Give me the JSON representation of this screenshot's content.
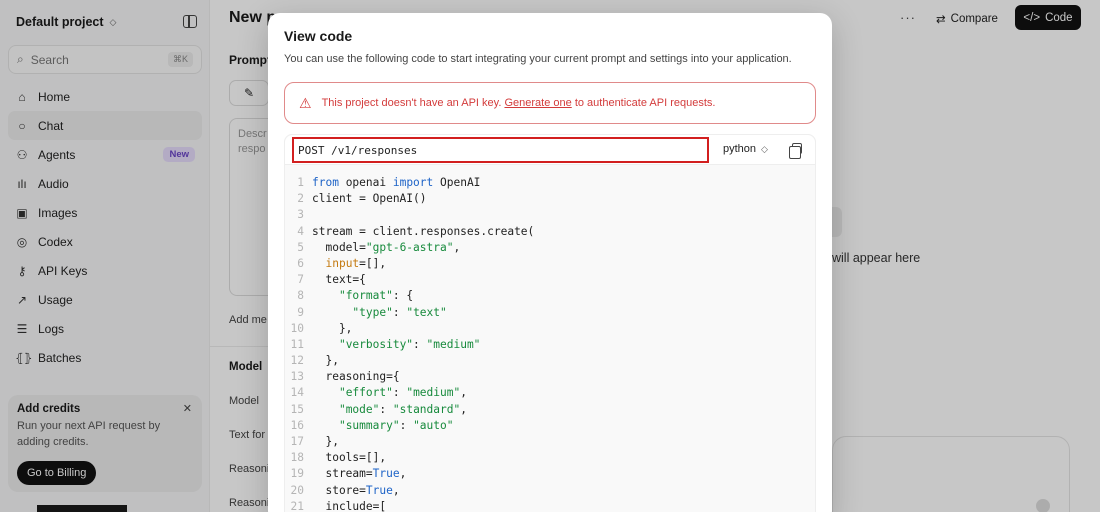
{
  "sidebar": {
    "project": "Default project",
    "search_placeholder": "Search",
    "search_shortcut": "⌘K",
    "items": [
      {
        "label": "Home",
        "icon": "home-icon"
      },
      {
        "label": "Chat",
        "icon": "chat-icon",
        "active": true
      },
      {
        "label": "Agents",
        "icon": "agents-icon",
        "badge": "New"
      },
      {
        "label": "Audio",
        "icon": "audio-icon"
      },
      {
        "label": "Images",
        "icon": "images-icon"
      },
      {
        "label": "Codex",
        "icon": "codex-icon"
      },
      {
        "label": "API Keys",
        "icon": "key-icon"
      },
      {
        "label": "Usage",
        "icon": "usage-icon"
      },
      {
        "label": "Logs",
        "icon": "logs-icon"
      },
      {
        "label": "Batches",
        "icon": "batches-icon"
      }
    ],
    "credits": {
      "title": "Add credits",
      "description": "Run your next API request by adding credits.",
      "button": "Go to Billing"
    }
  },
  "main": {
    "title": "New p",
    "compare": "Compare",
    "code": "Code",
    "prompt_label": "Prompt",
    "description_placeholder": "Descr respo",
    "add_message": "Add me",
    "model_header": "Model",
    "labels": [
      "Model",
      "Text for",
      "Reasoni",
      "Reasoni"
    ],
    "empty_state": "will appear here"
  },
  "modal": {
    "title": "View code",
    "subtitle": "You can use the following code to start integrating your current prompt and settings into your application.",
    "alert_before": "This project doesn't have an API key.",
    "alert_link": "Generate one",
    "alert_after": "to authenticate API requests.",
    "endpoint": "POST /v1/responses",
    "language": "python",
    "code_lines": [
      {
        "n": "1",
        "t": "from openai import OpenAI"
      },
      {
        "n": "2",
        "t": "client = OpenAI()"
      },
      {
        "n": "3",
        "t": ""
      },
      {
        "n": "4",
        "t": "stream = client.responses.create("
      },
      {
        "n": "5",
        "t": "  model=\"gpt-6-astra\","
      },
      {
        "n": "6",
        "t": "  input=[],"
      },
      {
        "n": "7",
        "t": "  text={"
      },
      {
        "n": "8",
        "t": "    \"format\": {"
      },
      {
        "n": "9",
        "t": "      \"type\": \"text\""
      },
      {
        "n": "10",
        "t": "    },"
      },
      {
        "n": "11",
        "t": "    \"verbosity\": \"medium\""
      },
      {
        "n": "12",
        "t": "  },"
      },
      {
        "n": "13",
        "t": "  reasoning={"
      },
      {
        "n": "14",
        "t": "    \"effort\": \"medium\","
      },
      {
        "n": "15",
        "t": "    \"mode\": \"standard\","
      },
      {
        "n": "16",
        "t": "    \"summary\": \"auto\""
      },
      {
        "n": "17",
        "t": "  },"
      },
      {
        "n": "18",
        "t": "  tools=[],"
      },
      {
        "n": "19",
        "t": "  stream=True,"
      },
      {
        "n": "20",
        "t": "  store=True,"
      },
      {
        "n": "21",
        "t": "  include=["
      }
    ]
  },
  "colors": {
    "accent_dark": "#111111",
    "alert_red": "#d33b3b",
    "endpoint_border": "#d21f1f",
    "keyword_blue": "#1d63c7",
    "string_green": "#178a3c",
    "param_orange": "#c47a10",
    "badge_purple": "#6b45c7"
  }
}
